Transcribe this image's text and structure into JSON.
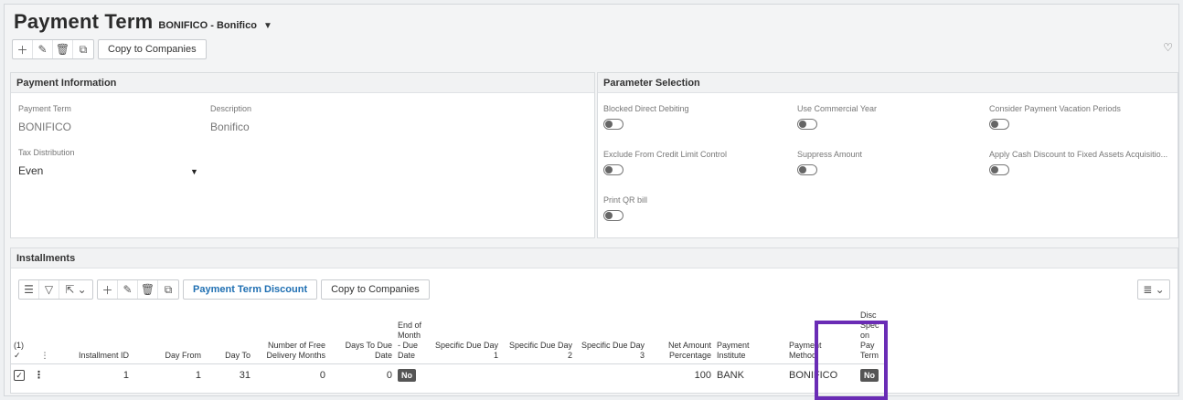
{
  "header": {
    "title": "Payment Term",
    "subtitle": "BONIFICO - Bonifico",
    "copy_label": "Copy to Companies"
  },
  "payment_information": {
    "heading": "Payment Information",
    "payment_term_label": "Payment Term",
    "payment_term_value": "BONIFICO",
    "description_label": "Description",
    "description_value": "Bonifico",
    "tax_label": "Tax Distribution",
    "tax_value": "Even"
  },
  "parameter_selection": {
    "heading": "Parameter Selection",
    "items": [
      {
        "label": "Blocked Direct Debiting",
        "on": false
      },
      {
        "label": "Use Commercial Year",
        "on": false
      },
      {
        "label": "Consider Payment Vacation Periods",
        "on": false
      },
      {
        "label": "Exclude From Credit Limit Control",
        "on": false
      },
      {
        "label": "Suppress Amount",
        "on": false
      },
      {
        "label": "Apply Cash Discount to Fixed Assets Acquisitio...",
        "on": false
      },
      {
        "label": "Print QR bill",
        "on": false
      }
    ]
  },
  "installments": {
    "heading": "Installments",
    "discount_label": "Payment Term Discount",
    "copy_label": "Copy to Companies",
    "selected_count": "(1)",
    "columns": {
      "installment_id": "Installment ID",
      "day_from": "Day From",
      "day_to": "Day To",
      "free_months_1": "Number of Free",
      "free_months_2": "Delivery Months",
      "days_due_1": "Days To Due",
      "days_due_2": "Date",
      "eom_1": "End of",
      "eom_2": "Month",
      "eom_3": "- Due",
      "eom_4": "Date",
      "sdd1_1": "Specific Due Day",
      "sdd1_2": "1",
      "sdd2_1": "Specific Due Day",
      "sdd2_2": "2",
      "sdd3_1": "Specific Due Day",
      "sdd3_2": "3",
      "net_1": "Net Amount",
      "net_2": "Percentage",
      "pi_1": "Payment",
      "pi_2": "Institute",
      "pm_1": "Payment",
      "pm_2": "Method",
      "disc_1": "Disc",
      "disc_2": "Spec",
      "disc_3": "on Pay",
      "disc_4": "Term"
    },
    "rows": [
      {
        "installment_id": "1",
        "day_from": "1",
        "day_to": "31",
        "free_months": "0",
        "days_due": "0",
        "end_of_month": "No",
        "net_pct": "100",
        "institute": "BANK",
        "method": "BONIFICO",
        "disc_spec": "No"
      }
    ]
  },
  "colors": {
    "accent": "#1f6fb2",
    "highlight": "#6a2cb5"
  }
}
